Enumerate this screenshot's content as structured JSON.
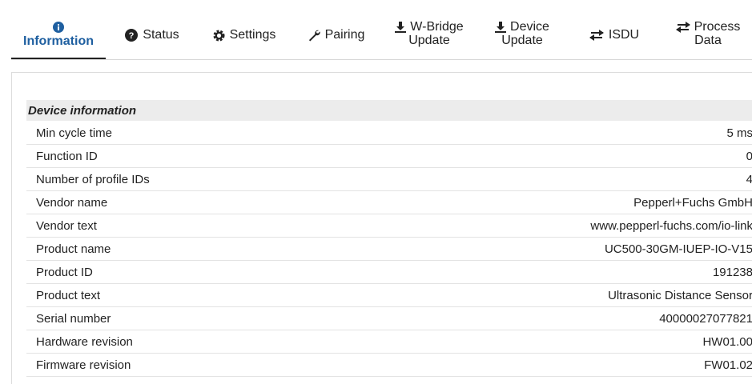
{
  "tabs": [
    {
      "label": "Information",
      "icon": "info-circle-icon",
      "active": true
    },
    {
      "label": "Status",
      "icon": "question-circle-icon"
    },
    {
      "label": "Settings",
      "icon": "gear-icon"
    },
    {
      "label": "Pairing",
      "icon": "wrench-icon"
    },
    {
      "label_top": "W-Bridge",
      "label_bottom": "Update",
      "icon": "download-icon"
    },
    {
      "label_top": "Device",
      "label_bottom": "Update",
      "icon": "download-icon"
    },
    {
      "label": "ISDU",
      "icon": "exchange-arrows-icon"
    },
    {
      "label_top": "Process",
      "label_bottom": "Data",
      "icon": "exchange-arrows-icon"
    }
  ],
  "section": {
    "title": "Device information",
    "rows": [
      {
        "label": "Min cycle time",
        "value": "5 ms"
      },
      {
        "label": "Function ID",
        "value": "0"
      },
      {
        "label": "Number of profile IDs",
        "value": "4"
      },
      {
        "label": "Vendor name",
        "value": "Pepperl+Fuchs GmbH"
      },
      {
        "label": "Vendor text",
        "value": "www.pepperl-fuchs.com/io-link"
      },
      {
        "label": "Product name",
        "value": "UC500-30GM-IUEP-IO-V15"
      },
      {
        "label": "Product ID",
        "value": "191238"
      },
      {
        "label": "Product text",
        "value": "Ultrasonic Distance Sensor"
      },
      {
        "label": "Serial number",
        "value": "40000027077821"
      },
      {
        "label": "Hardware revision",
        "value": "HW01.00"
      },
      {
        "label": "Firmware revision",
        "value": "FW01.02"
      }
    ]
  },
  "colors": {
    "active_tab": "#1e5fa0",
    "header_bg": "#ececec"
  }
}
